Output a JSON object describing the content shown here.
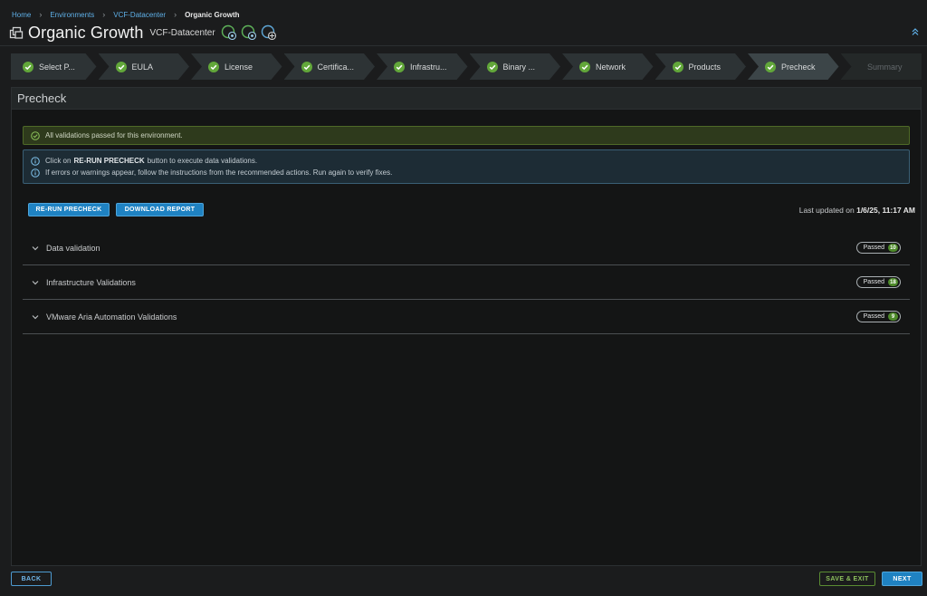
{
  "breadcrumb": {
    "items": [
      "Home",
      "Environments",
      "VCF-Datacenter"
    ],
    "current": "Organic Growth"
  },
  "header": {
    "title": "Organic Growth",
    "datacenter": "VCF-Datacenter"
  },
  "steps": [
    {
      "label": "Select P...",
      "status": "complete"
    },
    {
      "label": "EULA",
      "status": "complete"
    },
    {
      "label": "License",
      "status": "complete"
    },
    {
      "label": "Certifica...",
      "status": "complete"
    },
    {
      "label": "Infrastru...",
      "status": "complete"
    },
    {
      "label": "Binary ...",
      "status": "complete"
    },
    {
      "label": "Network",
      "status": "complete"
    },
    {
      "label": "Products",
      "status": "complete"
    },
    {
      "label": "Precheck",
      "status": "active"
    },
    {
      "label": "Summary",
      "status": "disabled"
    }
  ],
  "panel": {
    "title": "Precheck",
    "success_message": "All validations passed for this environment.",
    "info_line1_prefix": "Click on",
    "info_line1_bold": "RE-RUN PRECHECK",
    "info_line1_suffix": "button to execute data validations.",
    "info_line2": "If errors or warnings appear, follow the instructions from the recommended actions. Run again to verify fixes.",
    "rerun_label": "RE-RUN PRECHECK",
    "download_label": "DOWNLOAD REPORT",
    "last_updated_label": "Last updated on",
    "last_updated_value": "1/6/25, 11:17 AM",
    "sections": [
      {
        "name": "Data validation",
        "status": "Passed",
        "count": "10"
      },
      {
        "name": "Infrastructure Validations",
        "status": "Passed",
        "count": "18"
      },
      {
        "name": "VMware Aria Automation Validations",
        "status": "Passed",
        "count": "9"
      }
    ]
  },
  "footer": {
    "back_label": "BACK",
    "save_exit_label": "SAVE & EXIT",
    "next_label": "NEXT"
  },
  "colors": {
    "accent_blue": "#1f82c2",
    "success_green": "#4e8a2a",
    "link_blue": "#5fb0e8"
  }
}
